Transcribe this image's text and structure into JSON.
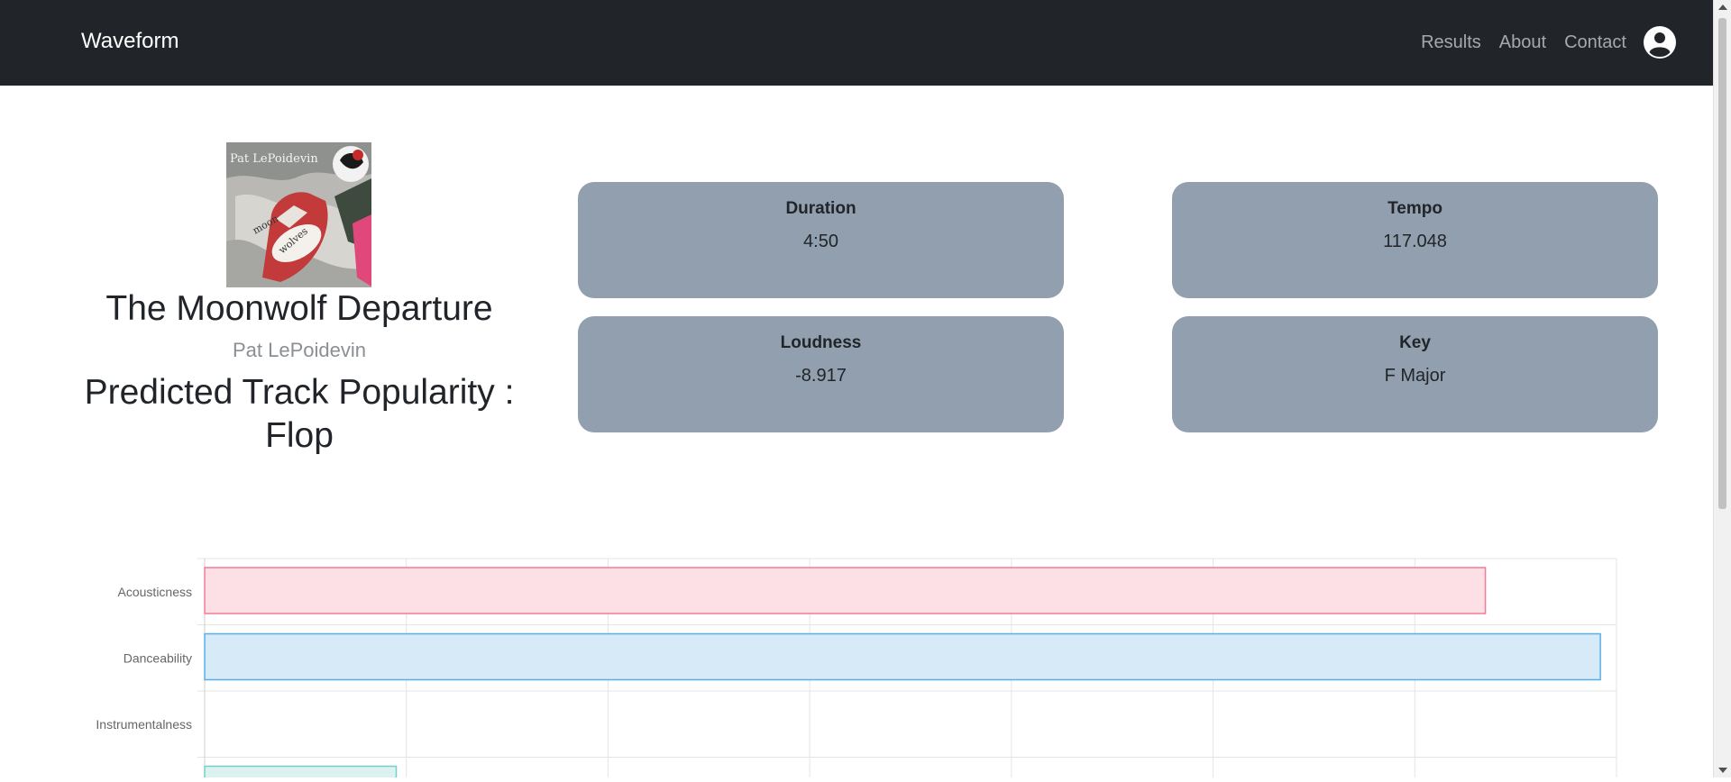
{
  "navbar": {
    "brand": "Waveform",
    "links": [
      "Results",
      "About",
      "Contact"
    ]
  },
  "track": {
    "title": "The Moonwolf Departure",
    "artist": "Pat LePoidevin",
    "prediction": "Predicted Track Popularity : Flop",
    "album_art_text": "Pat LePoidevin"
  },
  "cards": [
    {
      "label": "Duration",
      "value": "4:50"
    },
    {
      "label": "Tempo",
      "value": "117.048"
    },
    {
      "label": "Loudness",
      "value": "-8.917"
    },
    {
      "label": "Key",
      "value": "F Major"
    }
  ],
  "chart_data": {
    "type": "bar",
    "orientation": "horizontal",
    "categories": [
      "Acousticness",
      "Danceability",
      "Instrumentalness",
      ""
    ],
    "values": [
      0.635,
      0.692,
      0.0,
      0.095
    ],
    "xlim": [
      0,
      0.7
    ],
    "colors": {
      "fill": [
        "#fde0e6",
        "#d7eaf8",
        "#e6f6f6",
        "#dcf2f1"
      ],
      "stroke": [
        "#f27b96",
        "#5aaee8",
        "#73cfcb",
        "#73cfcb"
      ]
    },
    "grid": true
  },
  "colors": {
    "navbar_bg": "#212529",
    "card_bg": "#919fae"
  }
}
